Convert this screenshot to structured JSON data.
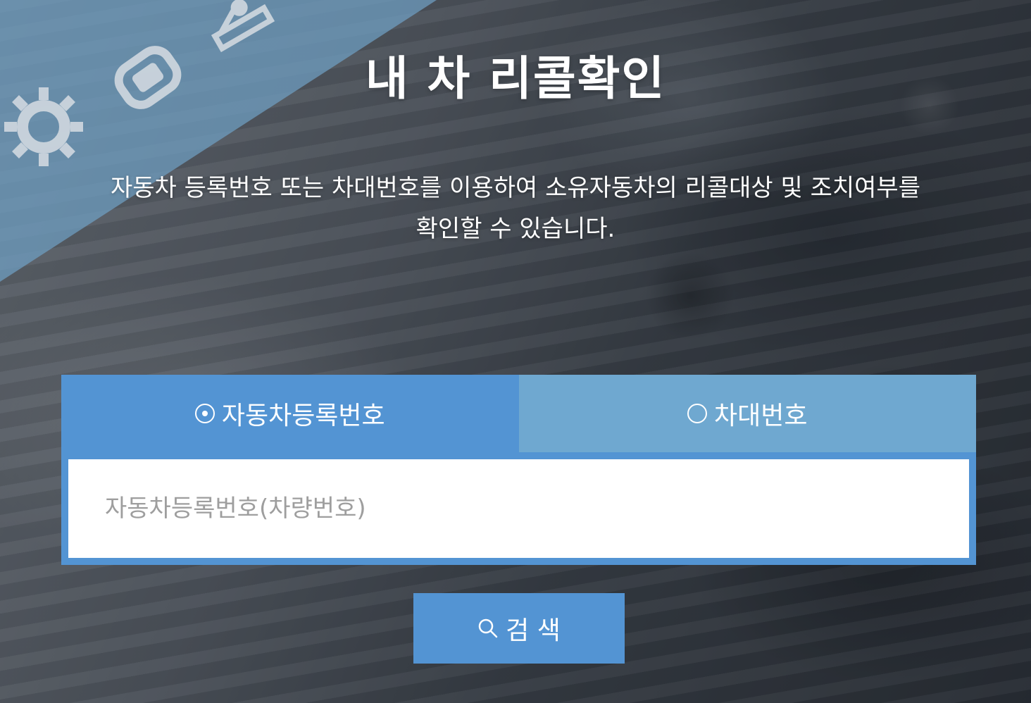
{
  "page": {
    "title": "내 차 리콜확인",
    "description_line1": "자동차 등록번호 또는 차대번호를 이용하여 소유자동차의 리콜대상 및 조치여부를",
    "description_line2": "확인할 수 있습니다."
  },
  "tabs": [
    {
      "label": "자동차등록번호",
      "selected": true
    },
    {
      "label": "차대번호",
      "selected": false
    }
  ],
  "search": {
    "placeholder": "자동차등록번호(차량번호)",
    "value": "",
    "button_label": "검 색"
  },
  "colors": {
    "accent": "#5394d3",
    "tab_inactive": "#6fa8d0",
    "ribbon": "#6f9fc4"
  },
  "icons": {
    "decorations": [
      "gear-icon",
      "car-icon",
      "mechanic-icon"
    ],
    "search": "search-icon"
  }
}
